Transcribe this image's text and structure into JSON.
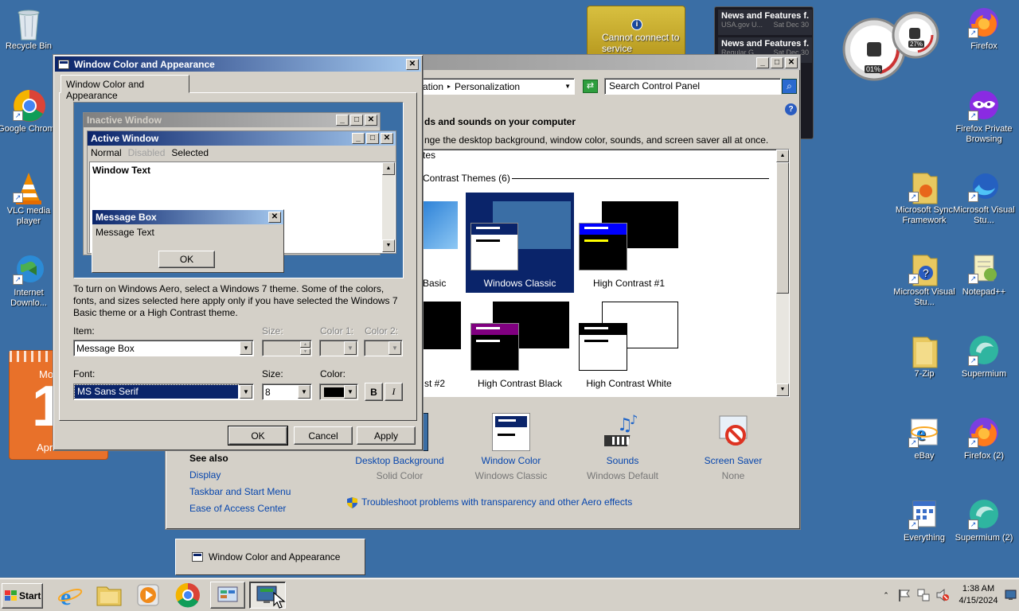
{
  "desktop": {
    "left_icons": [
      {
        "label": "Recycle Bin"
      },
      {
        "label": "Google Chrome"
      },
      {
        "label": "VLC media player"
      },
      {
        "label": "Internet Downlo..."
      }
    ],
    "right_icons": [
      {
        "label": "Firefox"
      },
      {
        "label": "Firefox Private Browsing"
      },
      {
        "label": "Microsoft Sync Framework"
      },
      {
        "label": "Microsoft Visual Stu..."
      },
      {
        "label": "Microsoft Visual Stu..."
      },
      {
        "label": "Notepad++"
      },
      {
        "label": "7-Zip"
      },
      {
        "label": "Supermium"
      },
      {
        "label": "eBay"
      },
      {
        "label": "Firefox (2)"
      },
      {
        "label": "Everything"
      },
      {
        "label": "Supermium (2)"
      }
    ]
  },
  "gadgets": {
    "weather_text": "Cannot connect to service",
    "weather_info_glyph": "i",
    "news_title": "News and Features f...",
    "news_items": [
      {
        "title": "News and Features f...",
        "sub": "USA.gov U...",
        "date": "Sat Dec 30"
      },
      {
        "title": "News and Features f...",
        "sub": "Regular G...",
        "date": "Sat Dec 30"
      }
    ],
    "meter_cpu": "01%",
    "meter_mem": "27%",
    "calendar_day": "1",
    "calendar_weekday": "Mo",
    "calendar_month": "Apr"
  },
  "control_panel": {
    "breadcrumb_part": "ation",
    "breadcrumb_sep": "▸",
    "breadcrumb_current": "Personalization",
    "search_placeholder": "Search Control Panel",
    "heading": "ds and sounds on your computer",
    "subtext": "nge the desktop background, window color, sounds, and screen saver all at once.",
    "list_top_label": "tes",
    "section_label": "Contrast Themes (6)",
    "themes": [
      {
        "label": "Basic"
      },
      {
        "label": "Windows Classic"
      },
      {
        "label": "High Contrast #1"
      },
      {
        "label": "st #2"
      },
      {
        "label": "High Contrast Black"
      },
      {
        "label": "High Contrast White"
      }
    ],
    "bottom_items": [
      {
        "label": "Desktop Background",
        "sub": "Solid Color"
      },
      {
        "label": "Window Color",
        "sub": "Windows Classic"
      },
      {
        "label": "Sounds",
        "sub": "Windows Default"
      },
      {
        "label": "Screen Saver",
        "sub": "None"
      }
    ],
    "see_also_title": "See also",
    "see_also_links": [
      "Display",
      "Taskbar and Start Menu",
      "Ease of Access Center"
    ],
    "troubleshoot_link": "Troubleshoot problems with transparency and other Aero effects",
    "help_glyph": "?"
  },
  "dialog": {
    "title": "Window Color and Appearance",
    "tab": "Window Color and Appearance",
    "preview": {
      "inactive_title": "Inactive Window",
      "active_title": "Active Window",
      "menu": [
        "Normal",
        "Disabled",
        "Selected"
      ],
      "window_text": "Window Text",
      "msgbox_title": "Message Box",
      "msgbox_text": "Message Text",
      "msgbox_ok": "OK"
    },
    "info_text": "To turn on Windows Aero, select a Windows 7 theme.  Some of the colors, fonts, and sizes selected here apply only if you have selected the Windows 7 Basic theme or a High Contrast theme.",
    "item_label": "Item:",
    "item_value": "Message Box",
    "size_label": "Size:",
    "color1_label": "Color 1:",
    "color2_label": "Color 2:",
    "font_label": "Font:",
    "font_value": "MS Sans Serif",
    "font_size_label": "Size:",
    "font_size_value": "8",
    "font_color_label": "Color:",
    "bold_label": "B",
    "italic_label": "I",
    "ok_label": "OK",
    "cancel_label": "Cancel",
    "apply_label": "Apply"
  },
  "taskbar_popup": {
    "label": "Window Color and Appearance"
  },
  "taskbar": {
    "start_label": "Start",
    "time": "1:38 AM",
    "date": "4/15/2024"
  },
  "colors": {
    "desktop": "#3a6ea5",
    "selection": "#0a246a",
    "link": "#0645ad"
  }
}
